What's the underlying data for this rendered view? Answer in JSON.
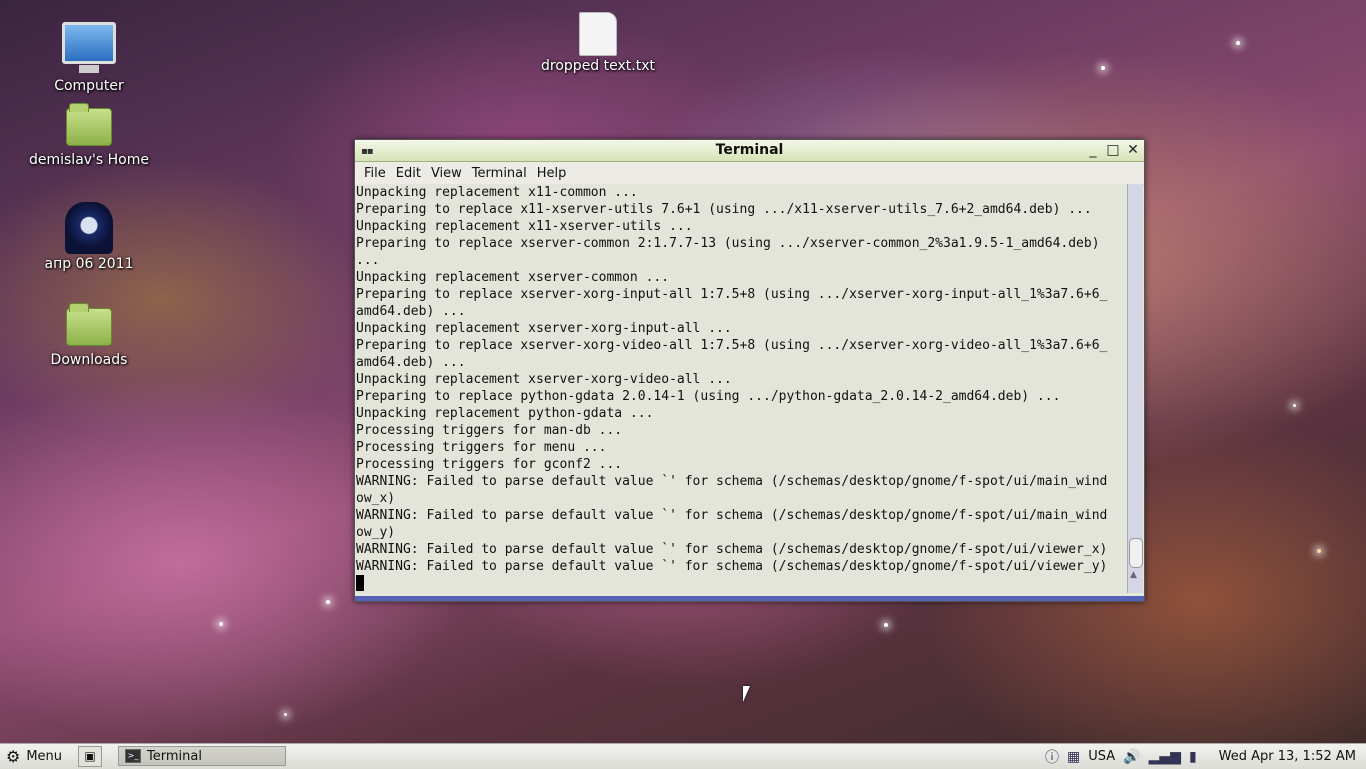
{
  "desktop": {
    "icons": [
      {
        "label": "Computer",
        "icon": "computer-icon"
      },
      {
        "label": "demislav's Home",
        "icon": "home-folder-icon"
      },
      {
        "label": "апр 06 2011",
        "icon": "user-avatar-icon"
      },
      {
        "label": "Downloads",
        "icon": "folder-icon"
      },
      {
        "label": "dropped text.txt",
        "icon": "text-file-icon"
      }
    ]
  },
  "window": {
    "title": "Terminal",
    "controls": {
      "minimize": "_",
      "maximize": "□",
      "close": "✕"
    },
    "menu": [
      "File",
      "Edit",
      "View",
      "Terminal",
      "Help"
    ],
    "lines": [
      "Unpacking replacement x11-common ...",
      "Preparing to replace x11-xserver-utils 7.6+1 (using .../x11-xserver-utils_7.6+2_amd64.deb) ...",
      "Unpacking replacement x11-xserver-utils ...",
      "Preparing to replace xserver-common 2:1.7.7-13 (using .../xserver-common_2%3a1.9.5-1_amd64.deb)",
      "...",
      "Unpacking replacement xserver-common ...",
      "Preparing to replace xserver-xorg-input-all 1:7.5+8 (using .../xserver-xorg-input-all_1%3a7.6+6_",
      "amd64.deb) ...",
      "Unpacking replacement xserver-xorg-input-all ...",
      "Preparing to replace xserver-xorg-video-all 1:7.5+8 (using .../xserver-xorg-video-all_1%3a7.6+6_",
      "amd64.deb) ...",
      "Unpacking replacement xserver-xorg-video-all ...",
      "Preparing to replace python-gdata 2.0.14-1 (using .../python-gdata_2.0.14-2_amd64.deb) ...",
      "Unpacking replacement python-gdata ...",
      "Processing triggers for man-db ...",
      "Processing triggers for menu ...",
      "Processing triggers for gconf2 ...",
      "WARNING: Failed to parse default value `' for schema (/schemas/desktop/gnome/f-spot/ui/main_wind",
      "ow_x)",
      "WARNING: Failed to parse default value `' for schema (/schemas/desktop/gnome/f-spot/ui/main_wind",
      "ow_y)",
      "WARNING: Failed to parse default value `' for schema (/schemas/desktop/gnome/f-spot/ui/viewer_x)",
      "WARNING: Failed to parse default value `' for schema (/schemas/desktop/gnome/f-spot/ui/viewer_y)"
    ]
  },
  "taskbar": {
    "menu_label": "Menu",
    "task_label": "Terminal",
    "keyboard_layout": "USA",
    "clock": "Wed Apr 13,  1:52 AM"
  }
}
